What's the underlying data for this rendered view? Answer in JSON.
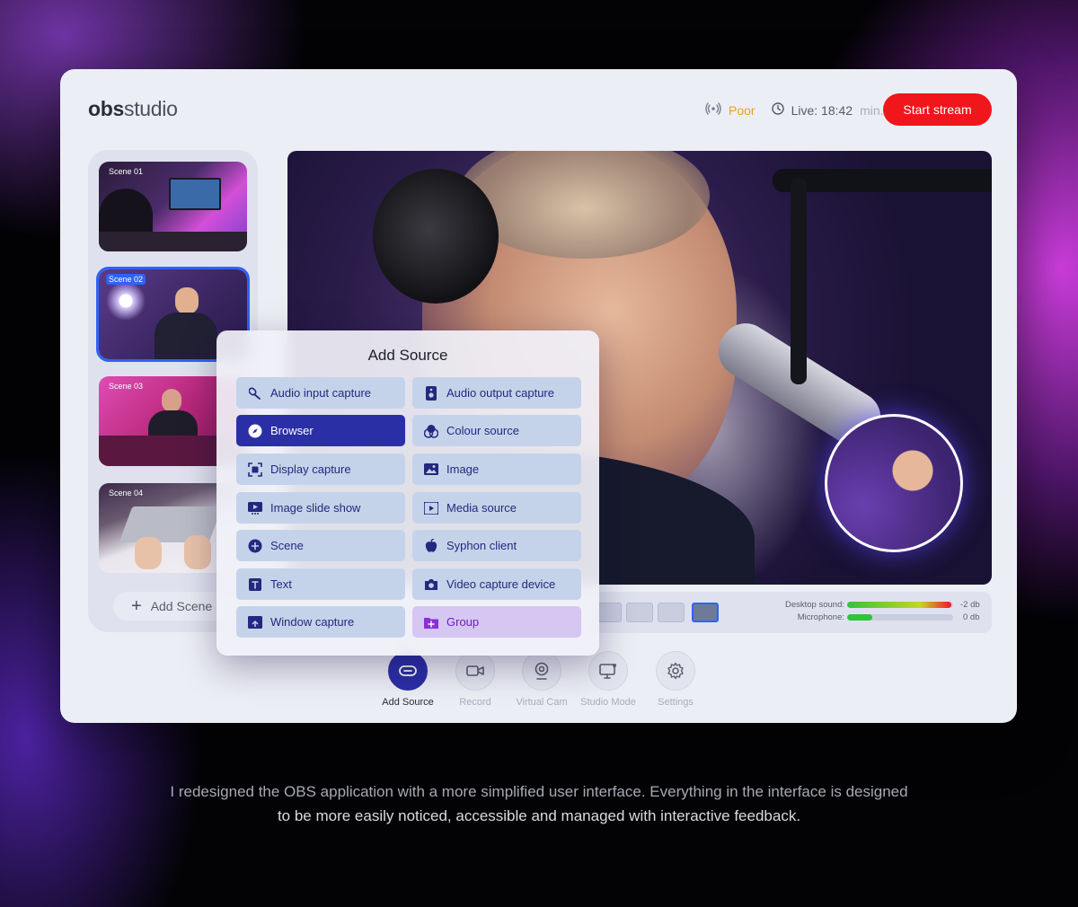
{
  "app": {
    "logo_bold": "obs",
    "logo_light": "studio"
  },
  "status": {
    "connection": "Poor",
    "live_label": "Live: 18:42",
    "live_unit": "min.",
    "start_button": "Start stream"
  },
  "scenes": {
    "items": [
      {
        "label": "Scene 01"
      },
      {
        "label": "Scene 02"
      },
      {
        "label": "Scene 03"
      },
      {
        "label": "Scene 04"
      }
    ],
    "active_index": 1,
    "add_label": "Add Scene"
  },
  "audio": {
    "desktop_label": "Desktop sound:",
    "desktop_db": "-2 db",
    "desktop_level": 0.98,
    "mic_label": "Microphone:",
    "mic_db": "0 db",
    "mic_level": 0.24
  },
  "add_source": {
    "title": "Add Source",
    "items": [
      {
        "label": "Audio input capture",
        "icon": "microphone-icon"
      },
      {
        "label": "Audio output capture",
        "icon": "speaker-icon"
      },
      {
        "label": "Browser",
        "icon": "compass-icon",
        "selected": true
      },
      {
        "label": "Colour source",
        "icon": "color-circles-icon"
      },
      {
        "label": "Display capture",
        "icon": "display-capture-icon"
      },
      {
        "label": "Image",
        "icon": "image-icon"
      },
      {
        "label": "Image slide show",
        "icon": "slideshow-icon"
      },
      {
        "label": "Media source",
        "icon": "media-icon"
      },
      {
        "label": "Scene",
        "icon": "plus-circle-icon"
      },
      {
        "label": "Syphon client",
        "icon": "apple-icon"
      },
      {
        "label": "Text",
        "icon": "text-icon"
      },
      {
        "label": "Video capture device",
        "icon": "camera-icon"
      },
      {
        "label": "Window capture",
        "icon": "window-icon"
      },
      {
        "label": "Group",
        "icon": "folder-icon"
      }
    ]
  },
  "toolbar": {
    "add_source": "Add Source",
    "record": "Record",
    "virtual_cam": "Virtual Cam",
    "studio_mode": "Studio Mode",
    "settings": "Settings"
  },
  "caption": {
    "line1": "I redesigned the OBS application with a more simplified user interface. Everything in the interface is designed",
    "line2": "to be more easily noticed, accessible and managed with interactive feedback."
  },
  "colors": {
    "accent": "#2b2fa6",
    "start_red": "#f0161b",
    "poor_orange": "#e7a21f",
    "scene_active": "#2f63f4",
    "group_purple": "#6a1fb8"
  }
}
